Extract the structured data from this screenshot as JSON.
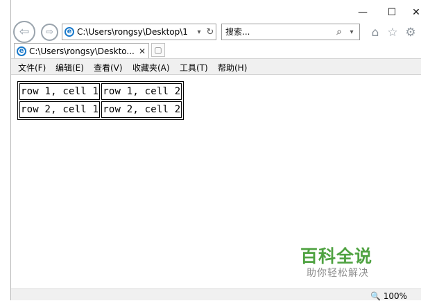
{
  "window": {
    "min": "—",
    "max": "☐",
    "close": "✕"
  },
  "address": {
    "url": "C:\\Users\\rongsy\\Desktop\\1",
    "dropdown": "▾",
    "refresh": "↻"
  },
  "search": {
    "placeholder": "搜索...",
    "icon": "search-icon",
    "dropdown": "▾"
  },
  "toolbar_icons": [
    "home-icon",
    "star-icon",
    "gear-icon"
  ],
  "tab": {
    "title": "C:\\Users\\rongsy\\Deskto...",
    "close": "✕"
  },
  "menu": [
    "文件(F)",
    "编辑(E)",
    "查看(V)",
    "收藏夹(A)",
    "工具(T)",
    "帮助(H)"
  ],
  "table": {
    "rows": [
      [
        "row 1, cell 1",
        "row 1, cell 2"
      ],
      [
        "row 2, cell 1",
        "row 2, cell 2"
      ]
    ]
  },
  "watermark": {
    "title": "百科全说",
    "subtitle": "助你轻松解决"
  },
  "status": {
    "zoom": "🔍 100%"
  }
}
